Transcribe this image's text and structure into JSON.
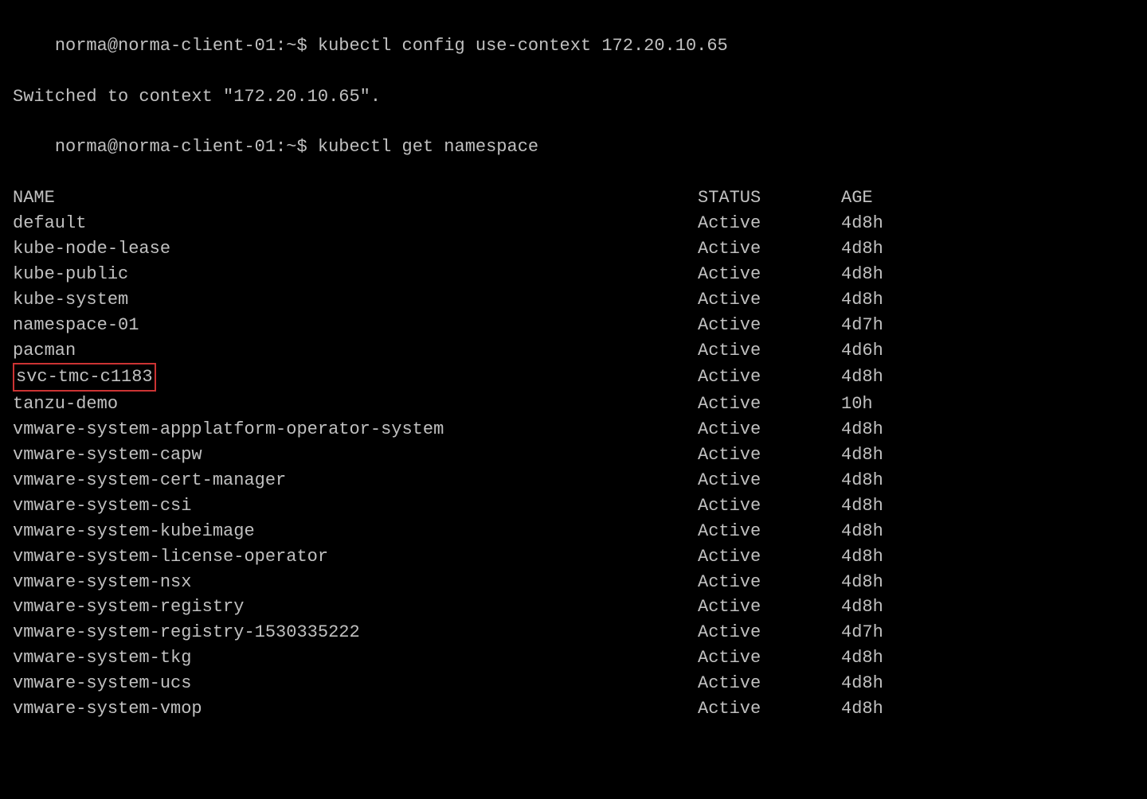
{
  "terminal": {
    "prompt1": "norma@norma-client-01:~$",
    "command1": " kubectl config use-context 172.20.10.65",
    "line2": "Switched to context \"172.20.10.65\".",
    "prompt2": "norma@norma-client-01:~$",
    "command2": " kubectl get namespace",
    "headers": {
      "name": "NAME",
      "status": "STATUS",
      "age": "AGE"
    },
    "rows": [
      {
        "name": "default",
        "status": "Active",
        "age": "4d8h",
        "highlight": false
      },
      {
        "name": "kube-node-lease",
        "status": "Active",
        "age": "4d8h",
        "highlight": false
      },
      {
        "name": "kube-public",
        "status": "Active",
        "age": "4d8h",
        "highlight": false
      },
      {
        "name": "kube-system",
        "status": "Active",
        "age": "4d8h",
        "highlight": false
      },
      {
        "name": "namespace-01",
        "status": "Active",
        "age": "4d7h",
        "highlight": false
      },
      {
        "name": "pacman",
        "status": "Active",
        "age": "4d6h",
        "highlight": false
      },
      {
        "name": "svc-tmc-c1183",
        "status": "Active",
        "age": "4d8h",
        "highlight": true
      },
      {
        "name": "tanzu-demo",
        "status": "Active",
        "age": "10h",
        "highlight": false
      },
      {
        "name": "vmware-system-appplatform-operator-system",
        "status": "Active",
        "age": "4d8h",
        "highlight": false
      },
      {
        "name": "vmware-system-capw",
        "status": "Active",
        "age": "4d8h",
        "highlight": false
      },
      {
        "name": "vmware-system-cert-manager",
        "status": "Active",
        "age": "4d8h",
        "highlight": false
      },
      {
        "name": "vmware-system-csi",
        "status": "Active",
        "age": "4d8h",
        "highlight": false
      },
      {
        "name": "vmware-system-kubeimage",
        "status": "Active",
        "age": "4d8h",
        "highlight": false
      },
      {
        "name": "vmware-system-license-operator",
        "status": "Active",
        "age": "4d8h",
        "highlight": false
      },
      {
        "name": "vmware-system-nsx",
        "status": "Active",
        "age": "4d8h",
        "highlight": false
      },
      {
        "name": "vmware-system-registry",
        "status": "Active",
        "age": "4d8h",
        "highlight": false
      },
      {
        "name": "vmware-system-registry-1530335222",
        "status": "Active",
        "age": "4d7h",
        "highlight": false
      },
      {
        "name": "vmware-system-tkg",
        "status": "Active",
        "age": "4d8h",
        "highlight": false
      },
      {
        "name": "vmware-system-ucs",
        "status": "Active",
        "age": "4d8h",
        "highlight": false
      },
      {
        "name": "vmware-system-vmop",
        "status": "Active",
        "age": "4d8h",
        "highlight": false
      }
    ]
  }
}
